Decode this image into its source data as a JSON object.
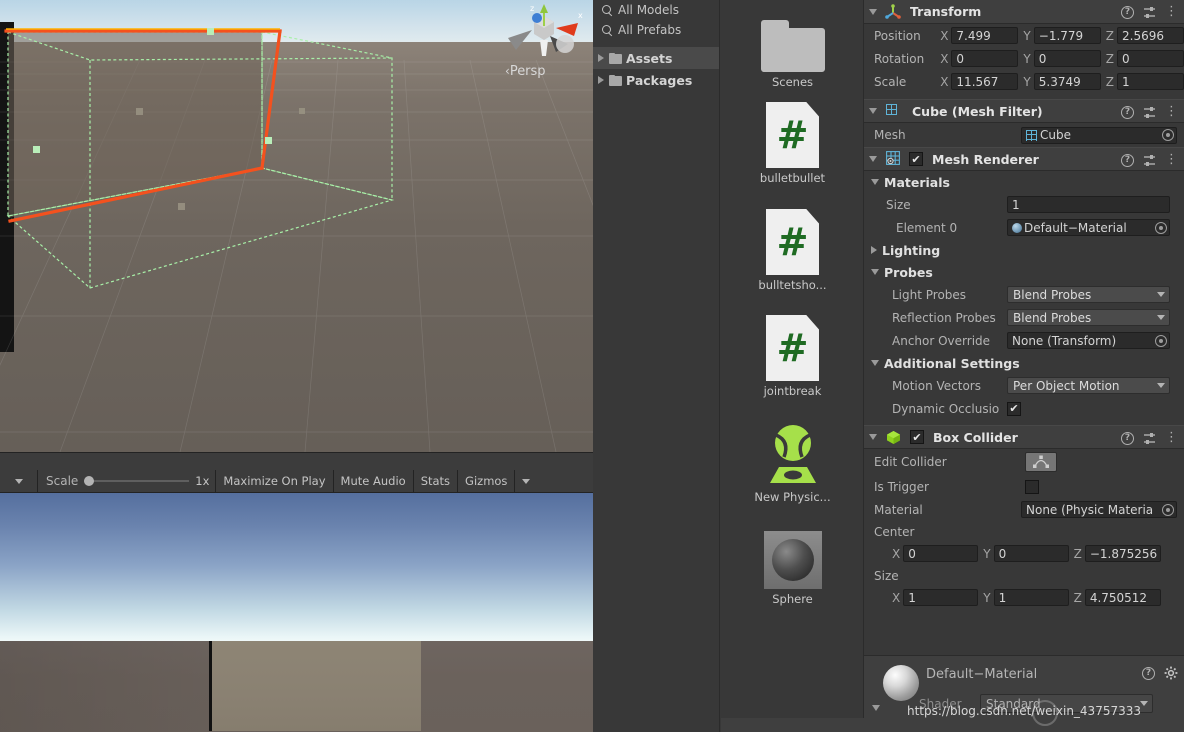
{
  "scene_view": {
    "projection_label": "Persp",
    "gizmo_axes": [
      "x",
      "y",
      "z"
    ]
  },
  "game_toolbar": {
    "scale_label": "Scale",
    "scale_value": "1x",
    "maximize_on_play": "Maximize On Play",
    "mute_audio": "Mute Audio",
    "stats": "Stats",
    "gizmos": "Gizmos",
    "menu_icon": "kebab-menu-icon"
  },
  "project": {
    "tree": {
      "searches": [
        {
          "label": "All Models",
          "icon": "search-icon"
        },
        {
          "label": "All Prefabs",
          "icon": "search-icon"
        }
      ],
      "folders": [
        {
          "label": "Assets",
          "selected": true
        },
        {
          "label": "Packages",
          "selected": false
        }
      ]
    },
    "assets": [
      {
        "label": "Scenes",
        "icon": "folder-icon",
        "type": "folder"
      },
      {
        "label": "bulletbullet",
        "icon": "csharp-script-icon",
        "type": "script",
        "glyph": "#"
      },
      {
        "label": "bulltetsho...",
        "icon": "csharp-script-icon",
        "type": "script",
        "glyph": "#"
      },
      {
        "label": "jointbreak",
        "icon": "csharp-script-icon",
        "type": "script",
        "glyph": "#"
      },
      {
        "label": "New Physic...",
        "icon": "physic-material-icon",
        "type": "physic_material"
      },
      {
        "label": "Sphere",
        "icon": "sphere-prefab-icon",
        "type": "prefab"
      }
    ]
  },
  "inspector": {
    "transform": {
      "title": "Transform",
      "icon": "transform-gizmo-icon",
      "rows": [
        {
          "label": "Position",
          "x": "7.499",
          "y": "−1.779",
          "z": "2.5696"
        },
        {
          "label": "Rotation",
          "x": "0",
          "y": "0",
          "z": "0"
        },
        {
          "label": "Scale",
          "x": "11.567",
          "y": "5.3749",
          "z": "1"
        }
      ],
      "axis_labels": [
        "X",
        "Y",
        "Z"
      ]
    },
    "mesh_filter": {
      "title": "Cube (Mesh Filter)",
      "icon": "mesh-filter-icon",
      "mesh_label": "Mesh",
      "mesh_value": "Cube"
    },
    "mesh_renderer": {
      "title": "Mesh Renderer",
      "icon": "mesh-renderer-icon",
      "enabled": true,
      "materials": {
        "section": "Materials",
        "size_label": "Size",
        "size_value": "1",
        "element_label": "Element 0",
        "element_value": "Default−Material"
      },
      "lighting_section": "Lighting",
      "probes": {
        "section": "Probes",
        "light_probes_label": "Light Probes",
        "light_probes_value": "Blend Probes",
        "reflection_probes_label": "Reflection Probes",
        "reflection_probes_value": "Blend Probes",
        "anchor_override_label": "Anchor Override",
        "anchor_override_value": "None (Transform)"
      },
      "additional": {
        "section": "Additional Settings",
        "motion_vectors_label": "Motion Vectors",
        "motion_vectors_value": "Per Object Motion",
        "dynamic_occlusion_label": "Dynamic Occlusio",
        "dynamic_occlusion_checked": true
      }
    },
    "box_collider": {
      "title": "Box Collider",
      "icon": "box-collider-icon",
      "enabled": true,
      "edit_collider_label": "Edit Collider",
      "is_trigger_label": "Is Trigger",
      "is_trigger_checked": false,
      "material_label": "Material",
      "material_value": "None (Physic Materia",
      "center_label": "Center",
      "center": {
        "x": "0",
        "y": "0",
        "z": "−1.875256"
      },
      "size_label": "Size",
      "size": {
        "x": "1",
        "y": "1",
        "z": "4.750512"
      },
      "axis_labels": [
        "X",
        "Y",
        "Z"
      ]
    },
    "material_preview": {
      "name": "Default−Material",
      "shader_label": "Shader",
      "shader_value": "Standard"
    }
  },
  "watermark": {
    "text": "https://blog.csdn.net/weixin_43757333"
  },
  "colors": {
    "panel_bg": "#383838",
    "header_bg": "#3f3f3f",
    "field_bg": "#2b2b2b",
    "dropdown_bg": "#4b4b4b",
    "selection_orange": "#f4511e",
    "collider_green": "#a0f0a0",
    "unity_green": "#8fd21e"
  }
}
